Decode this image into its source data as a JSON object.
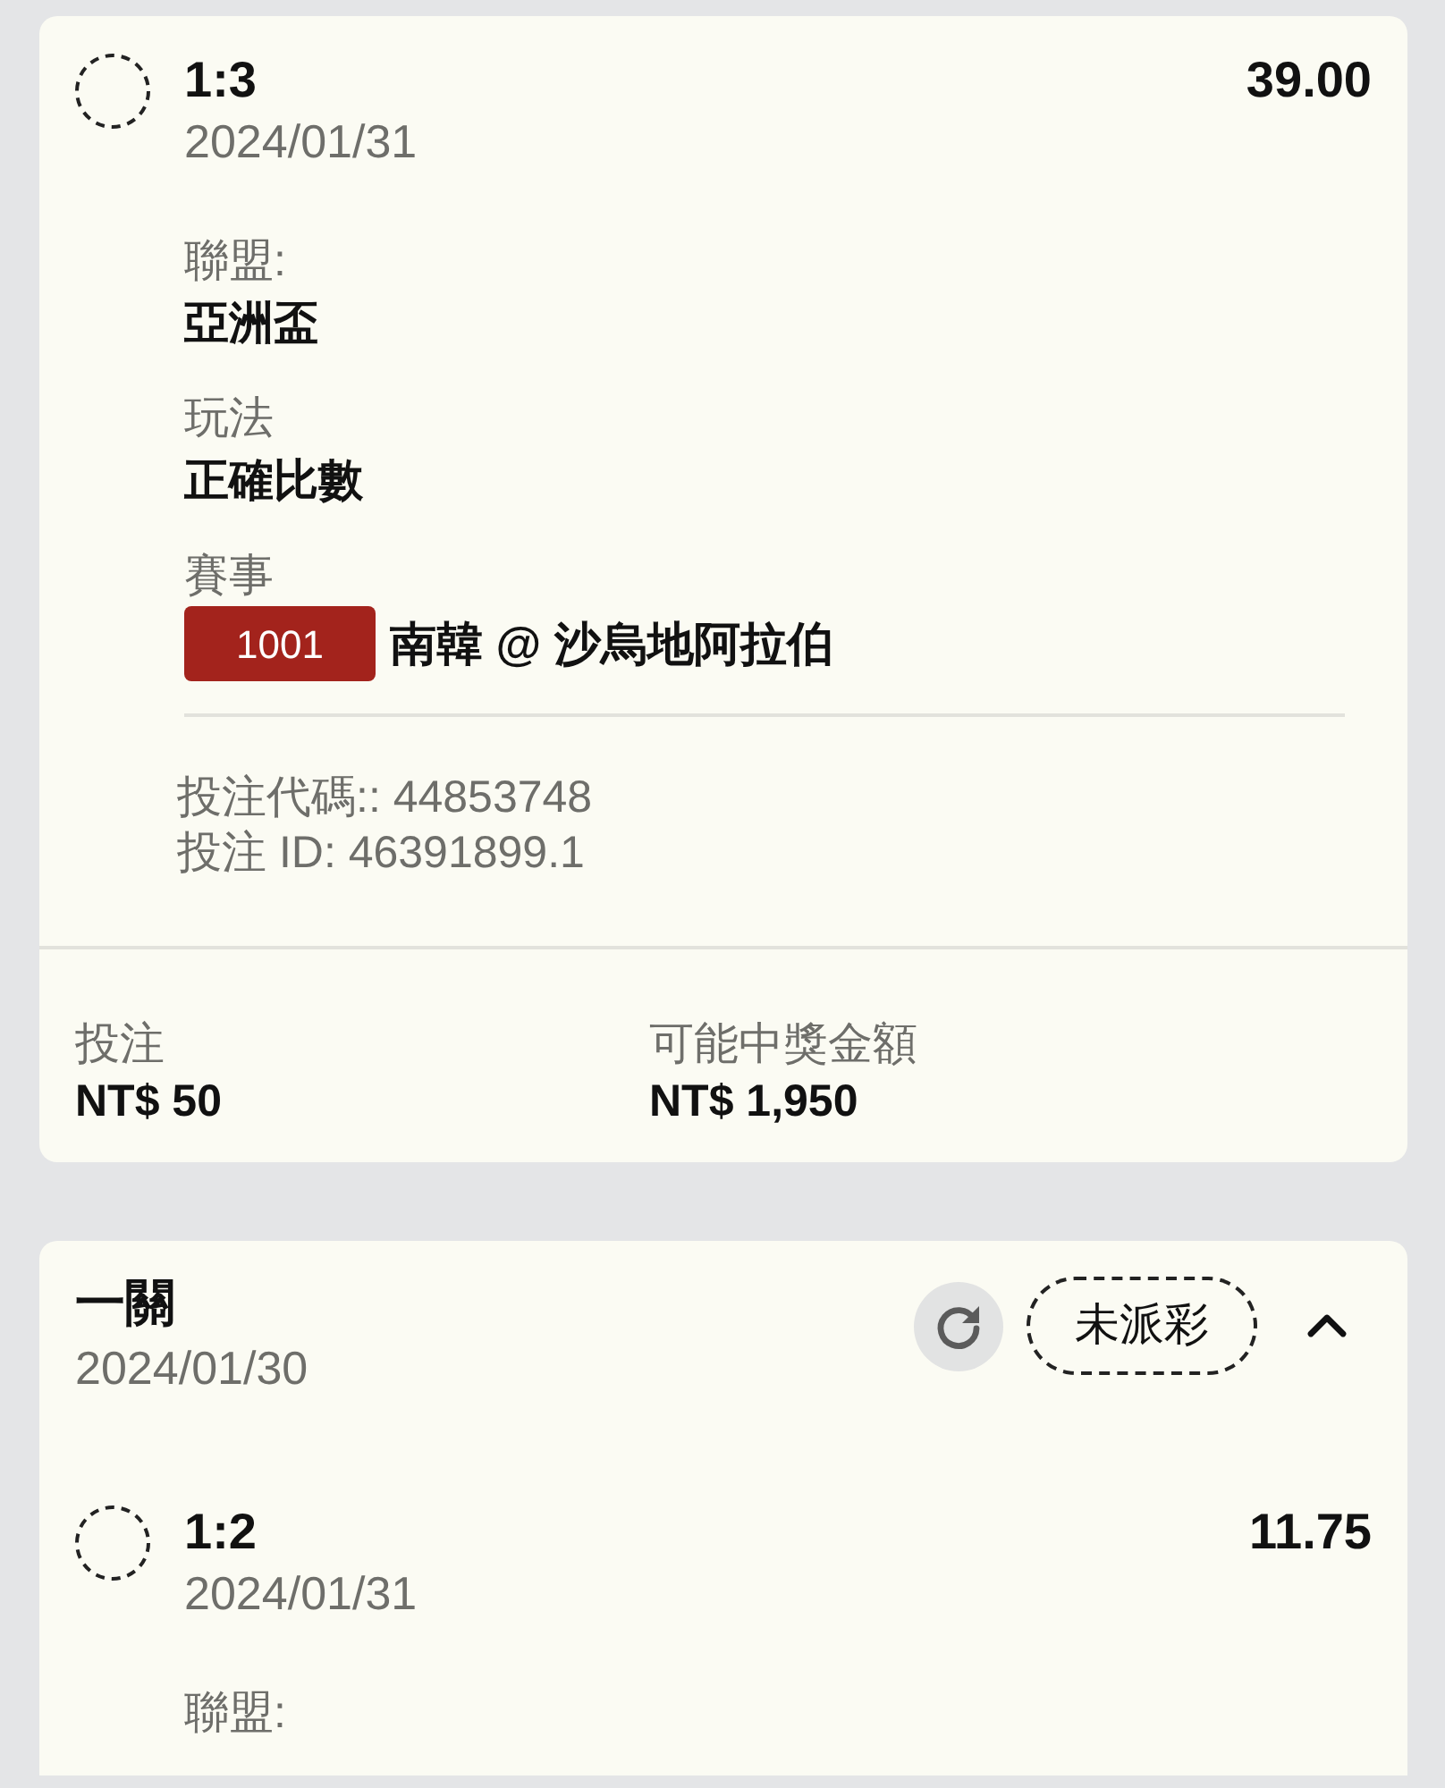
{
  "bets": [
    {
      "selections": [
        {
          "score": "1:3",
          "date": "2024/01/31",
          "odds": "39.00",
          "details": [
            {
              "label": "聯盟:",
              "value": "亞洲盃"
            },
            {
              "label": "玩法",
              "value": "正確比數"
            },
            {
              "label": "賽事",
              "match_code": "1001",
              "value": "南韓 @ 沙烏地阿拉伯"
            }
          ],
          "bet_code": "投注代碼:: 44853748",
          "bet_id": "投注 ID: 46391899.1"
        }
      ],
      "stake_label": "投注",
      "stake": "NT$ 50",
      "payout_label": "可能中獎金額",
      "payout": "NT$ 1,950"
    },
    {
      "title": "一關",
      "date": "2024/01/30",
      "status": "未派彩",
      "expanded": true,
      "selections": [
        {
          "score": "1:2",
          "date": "2024/01/31",
          "odds": "11.75",
          "details": [
            {
              "label": "聯盟:"
            }
          ]
        }
      ]
    }
  ]
}
